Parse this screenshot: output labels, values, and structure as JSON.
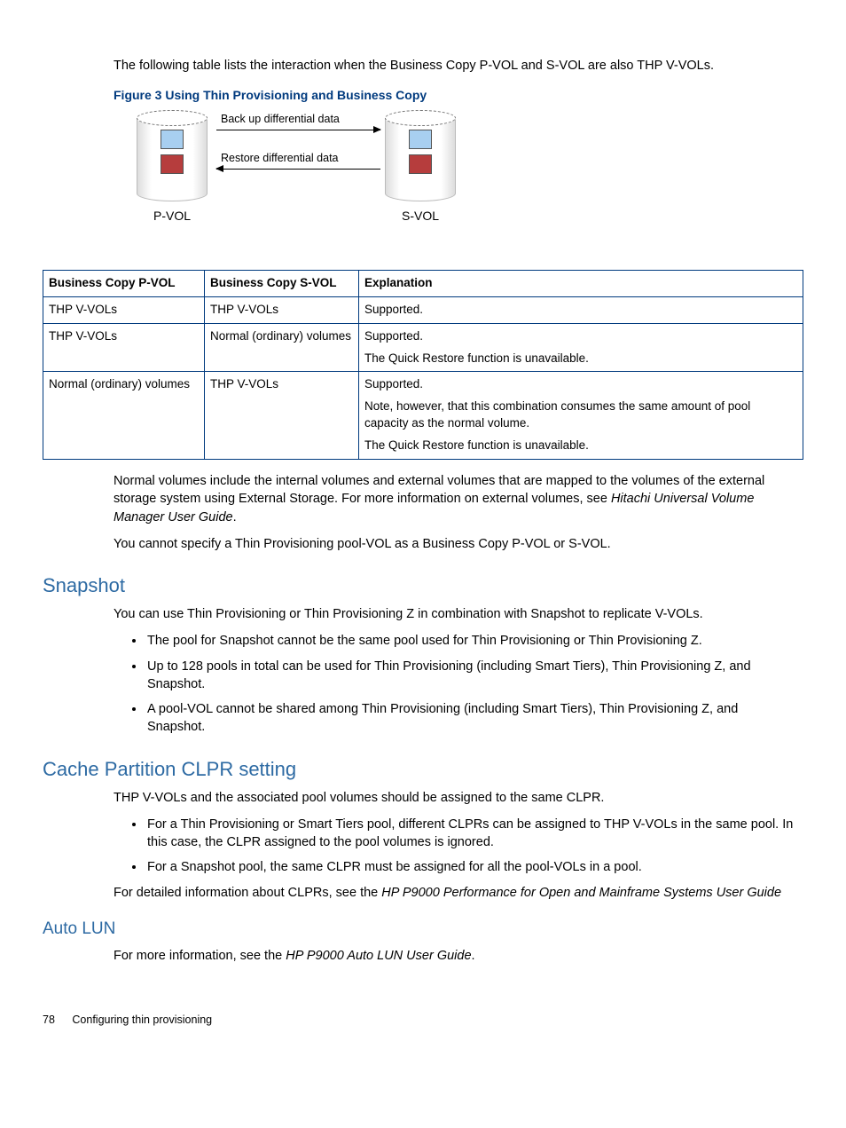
{
  "intro": "The following table lists the interaction when the Business Copy P-VOL and S-VOL are also THP V-VOLs.",
  "figure": {
    "caption": "Figure 3 Using Thin Provisioning and Business Copy",
    "backup_label": "Back up differential data",
    "restore_label": "Restore differential data",
    "pvol": "P-VOL",
    "svol": "S-VOL"
  },
  "table": {
    "headers": [
      "Business Copy P-VOL",
      "Business Copy S-VOL",
      "Explanation"
    ],
    "rows": [
      {
        "c0": "THP V-VOLs",
        "c1": "THP V-VOLs",
        "c2": [
          "Supported."
        ]
      },
      {
        "c0": "THP V-VOLs",
        "c1": "Normal (ordinary) volumes",
        "c2": [
          "Supported.",
          "The Quick Restore function is unavailable."
        ]
      },
      {
        "c0": "Normal (ordinary) volumes",
        "c1": "THP V-VOLs",
        "c2": [
          "Supported.",
          "Note, however, that this combination consumes the same amount of pool capacity as the normal volume.",
          "The Quick Restore function is unavailable."
        ]
      }
    ]
  },
  "after_table_p1a": "Normal volumes include the internal volumes and external volumes that are mapped to the volumes of the external storage system using External Storage. For more information on external volumes, see ",
  "after_table_p1b": "Hitachi Universal Volume Manager User Guide",
  "after_table_p1c": ".",
  "after_table_p2": "You cannot specify a Thin Provisioning pool-VOL as a Business Copy P-VOL or S-VOL.",
  "snapshot": {
    "title": "Snapshot",
    "intro": "You can use Thin Provisioning or Thin Provisioning Z in combination with Snapshot to replicate V-VOLs.",
    "bullets": [
      "The pool for Snapshot cannot be the same pool used for Thin Provisioning or Thin Provisioning Z.",
      "Up to 128 pools in total can be used for Thin Provisioning (including Smart Tiers), Thin Provisioning Z, and Snapshot.",
      "A pool-VOL cannot be shared among Thin Provisioning (including Smart Tiers), Thin Provisioning Z, and Snapshot."
    ]
  },
  "clpr": {
    "title": "Cache Partition CLPR setting",
    "intro": "THP V-VOLs and the associated pool volumes should be assigned to the same CLPR.",
    "bullets": [
      "For a Thin Provisioning or Smart Tiers pool, different CLPRs can be assigned to THP V-VOLs in the same pool. In this case, the CLPR assigned to the pool volumes is ignored.",
      "For a Snapshot pool, the same CLPR must be assigned for all the pool-VOLs in a pool."
    ],
    "outro_a": "For detailed information about CLPRs, see the ",
    "outro_b": "HP P9000 Performance for Open and Mainframe Systems User Guide"
  },
  "autolun": {
    "title": "Auto LUN",
    "text_a": "For more information, see the ",
    "text_b": "HP P9000 Auto LUN User Guide",
    "text_c": "."
  },
  "footer": {
    "page": "78",
    "section": "Configuring thin provisioning"
  }
}
